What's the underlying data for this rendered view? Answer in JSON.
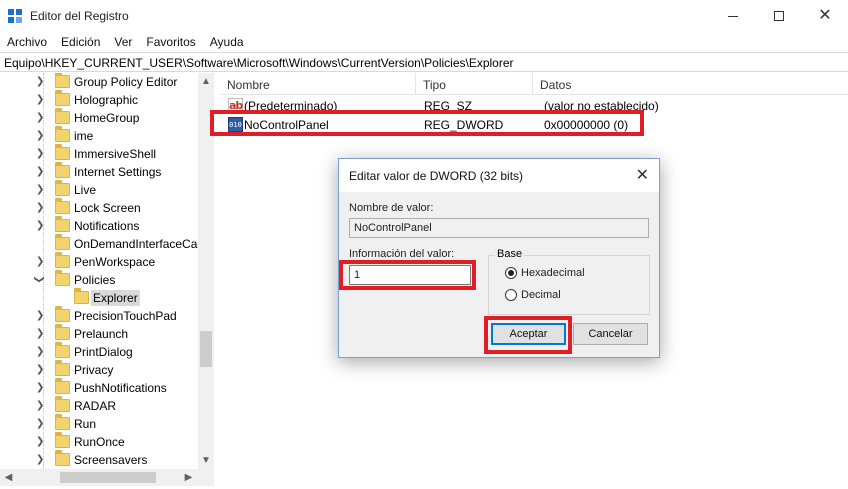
{
  "window": {
    "title": "Editor del Registro",
    "close_glyph": "✕"
  },
  "menu": [
    "Archivo",
    "Edición",
    "Ver",
    "Favoritos",
    "Ayuda"
  ],
  "address": "Equipo\\HKEY_CURRENT_USER\\Software\\Microsoft\\Windows\\CurrentVersion\\Policies\\Explorer",
  "tree": {
    "items": [
      {
        "label": "Group Policy Editor"
      },
      {
        "label": "Holographic"
      },
      {
        "label": "HomeGroup"
      },
      {
        "label": "ime"
      },
      {
        "label": "ImmersiveShell"
      },
      {
        "label": "Internet Settings"
      },
      {
        "label": "Live"
      },
      {
        "label": "Lock Screen"
      },
      {
        "label": "Notifications"
      },
      {
        "label": "OnDemandInterfaceCac"
      },
      {
        "label": "PenWorkspace"
      },
      {
        "label": "Policies"
      },
      {
        "label": "Explorer"
      },
      {
        "label": "PrecisionTouchPad"
      },
      {
        "label": "Prelaunch"
      },
      {
        "label": "PrintDialog"
      },
      {
        "label": "Privacy"
      },
      {
        "label": "PushNotifications"
      },
      {
        "label": "RADAR"
      },
      {
        "label": "Run"
      },
      {
        "label": "RunOnce"
      },
      {
        "label": "Screensavers"
      }
    ],
    "selected": "Explorer"
  },
  "list": {
    "columns": [
      "Nombre",
      "Tipo",
      "Datos"
    ],
    "rows": [
      {
        "icon": "string-value-icon",
        "icon_text": "ab",
        "name": "(Predeterminado)",
        "type": "REG_SZ",
        "data": "(valor no establecido)"
      },
      {
        "icon": "dword-value-icon",
        "icon_text": "010",
        "name": "NoControlPanel",
        "type": "REG_DWORD",
        "data": "0x00000000 (0)"
      }
    ]
  },
  "dialog": {
    "title": "Editar valor de DWORD (32 bits)",
    "value_name_label": "Nombre de valor:",
    "value_name": "NoControlPanel",
    "value_data_label": "Información del valor:",
    "value_data": "1",
    "base_label": "Base",
    "base_options": [
      {
        "label": "Hexadecimal",
        "checked": true
      },
      {
        "label": "Decimal",
        "checked": false
      }
    ],
    "ok_label": "Aceptar",
    "cancel_label": "Cancelar"
  },
  "colors": {
    "annotation_red": "#e01e26",
    "folder_yellow": "#f3d36b",
    "accent_blue": "#0078d7"
  }
}
